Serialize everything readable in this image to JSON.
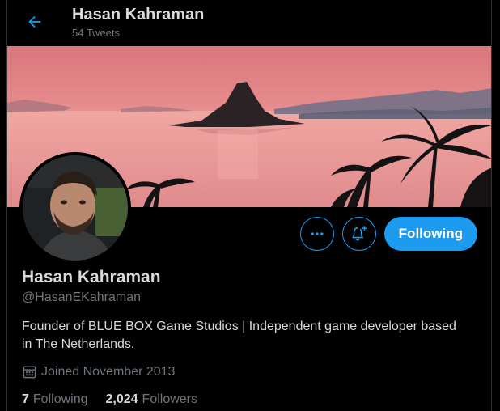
{
  "header": {
    "title": "Hasan Kahraman",
    "subtitle": "54 Tweets",
    "back_icon": "arrow-left-icon"
  },
  "actions": {
    "more_icon": "more-horizontal-icon",
    "notify_icon": "bell-plus-icon",
    "follow_label": "Following"
  },
  "profile": {
    "name": "Hasan Kahraman",
    "handle": "@HasanEKahraman",
    "bio": "Founder of BLUE BOX Game Studios | Independent game developer based in The Netherlands.",
    "joined": "Joined November 2013",
    "joined_icon": "calendar-icon",
    "following_count": "7",
    "following_label": "Following",
    "followers_count": "2,024",
    "followers_label": "Followers"
  },
  "colors": {
    "accent": "#1d9bf0",
    "background": "#000000",
    "text_primary": "#d9d9d9",
    "text_secondary": "#6e767d"
  }
}
